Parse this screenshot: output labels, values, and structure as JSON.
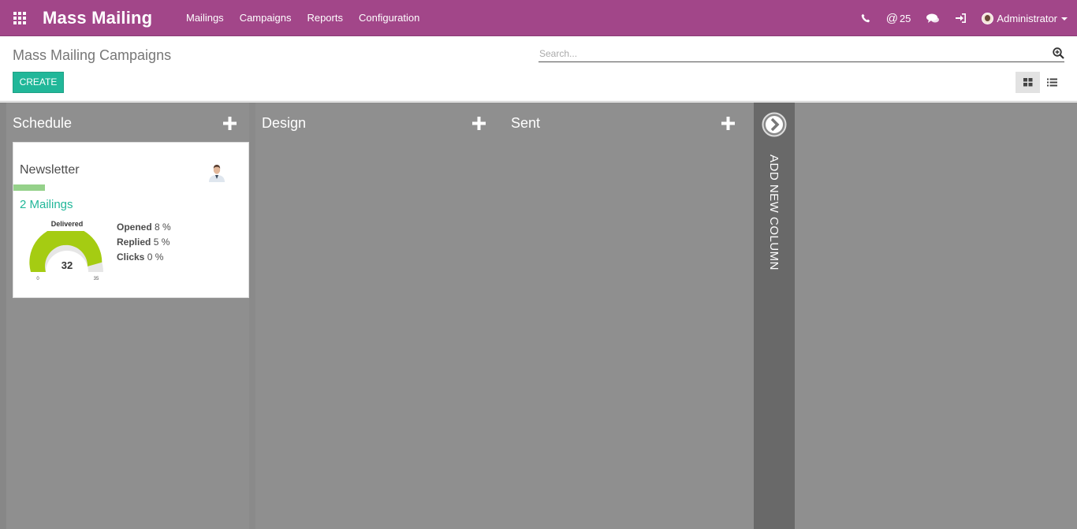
{
  "navbar": {
    "app_title": "Mass Mailing",
    "menu": [
      "Mailings",
      "Campaigns",
      "Reports",
      "Configuration"
    ],
    "mentions_count": "25",
    "user_name": "Administrator",
    "color": "#a24689"
  },
  "control_panel": {
    "breadcrumb": "Mass Mailing Campaigns",
    "search_placeholder": "Search...",
    "create_label": "CREATE"
  },
  "kanban": {
    "columns": [
      {
        "title": "Schedule"
      },
      {
        "title": "Design"
      },
      {
        "title": "Sent"
      }
    ],
    "add_column_label": "ADD NEW COLUMN",
    "card": {
      "title": "Newsletter",
      "mailings_link": "2 Mailings",
      "gauge": {
        "label": "Delivered",
        "value": "32",
        "min": "0",
        "max": "35"
      },
      "stats": [
        {
          "label": "Opened",
          "value": "8 %"
        },
        {
          "label": "Replied",
          "value": "5 %"
        },
        {
          "label": "Clicks",
          "value": "0 %"
        }
      ],
      "color_tag": "#95d18a"
    }
  },
  "accent_color": "#21b799"
}
